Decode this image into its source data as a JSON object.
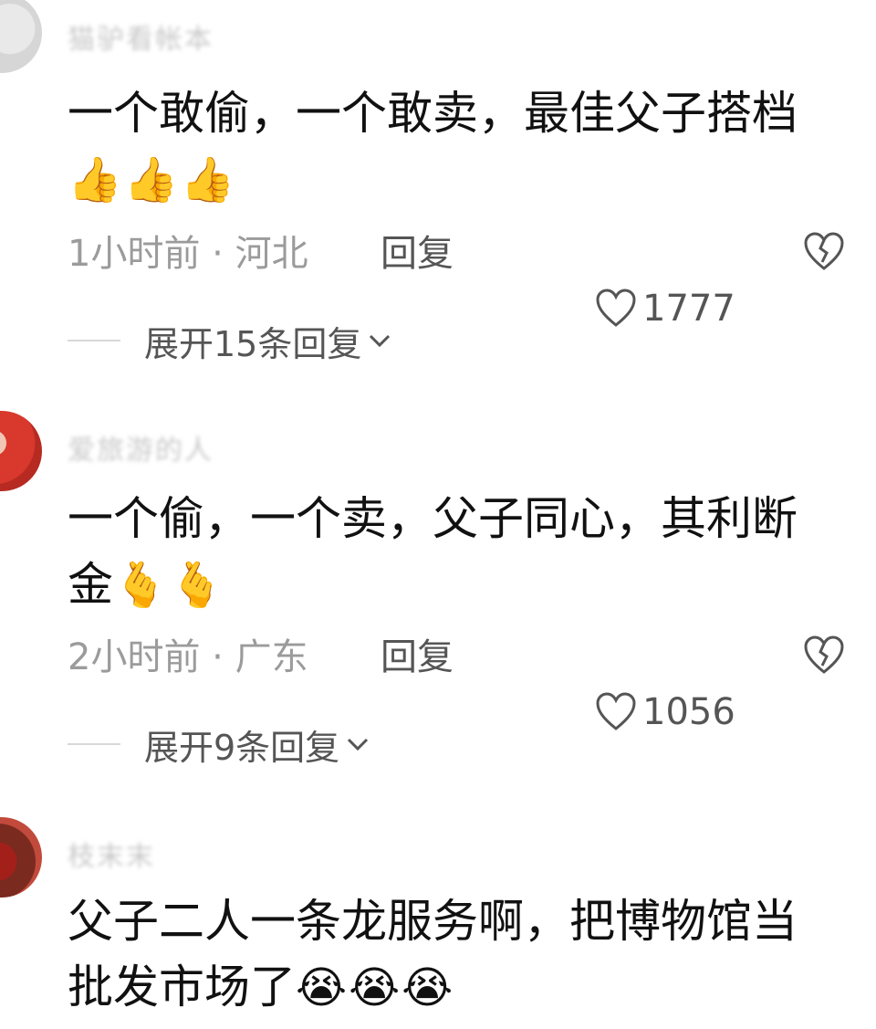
{
  "comments": [
    {
      "username": "猫驴看帐本",
      "text": "一个敢偷，一个敢卖，最佳父子搭档",
      "emoji": "👍👍👍",
      "time_location": "1小时前 · 河北",
      "reply_label": "回复",
      "likes": "1777",
      "expand_label": "展开15条回复"
    },
    {
      "username": "爱旅游的人",
      "text": "一个偷，一个卖，父子同心，其利断金",
      "emoji": "🫰🫰",
      "time_location": "2小时前 · 广东",
      "reply_label": "回复",
      "likes": "1056",
      "expand_label": "展开9条回复"
    },
    {
      "username": "枝末末",
      "text": "父子二人一条龙服务啊，把博物馆当批发市场了",
      "emoji": "😭😭😭"
    }
  ]
}
